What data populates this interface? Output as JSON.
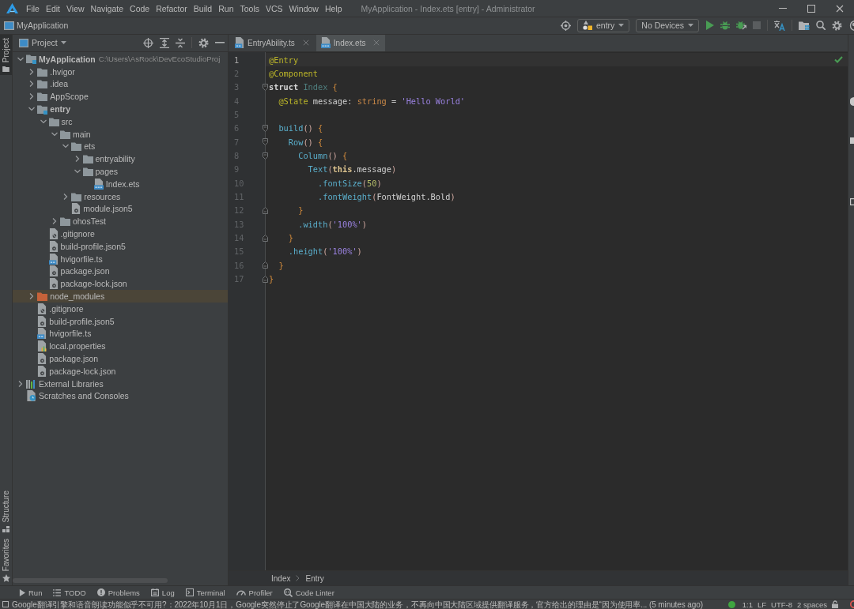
{
  "title_bar": {
    "menu": [
      "File",
      "Edit",
      "View",
      "Navigate",
      "Code",
      "Refactor",
      "Build",
      "Run",
      "Tools",
      "VCS",
      "Window",
      "Help"
    ],
    "title": "MyApplication - Index.ets [entry] - Administrator"
  },
  "nav_bar": {
    "project": "MyApplication",
    "run_config": "entry",
    "device": "No Devices"
  },
  "left_stripe": {
    "top": [
      {
        "label": "Project",
        "kind": "project",
        "selected": true
      }
    ],
    "bottom": [
      {
        "label": "Structure",
        "kind": "structure",
        "selected": false
      },
      {
        "label": "Favorites",
        "kind": "favorites",
        "selected": false
      }
    ]
  },
  "project_panel": {
    "title": "Project",
    "tree": [
      {
        "name": "MyApplication",
        "kind": "module",
        "hint": "C:\\Users\\AsRock\\DevEcoStudioProj",
        "expanded": true,
        "selected": false,
        "children": [
          {
            "name": ".hvigor",
            "kind": "folder",
            "expanded": false,
            "selected": false
          },
          {
            "name": ".idea",
            "kind": "folder",
            "expanded": false,
            "selected": false
          },
          {
            "name": "AppScope",
            "kind": "folder",
            "expanded": false,
            "selected": false
          },
          {
            "name": "entry",
            "kind": "module",
            "expanded": true,
            "selected": false,
            "children": [
              {
                "name": "src",
                "kind": "folder",
                "expanded": true,
                "selected": false,
                "children": [
                  {
                    "name": "main",
                    "kind": "folder",
                    "expanded": true,
                    "selected": false,
                    "children": [
                      {
                        "name": "ets",
                        "kind": "folder",
                        "expanded": true,
                        "selected": false,
                        "children": [
                          {
                            "name": "entryability",
                            "kind": "folder",
                            "expanded": false,
                            "selected": false
                          },
                          {
                            "name": "pages",
                            "kind": "folder",
                            "expanded": true,
                            "selected": false,
                            "children": [
                              {
                                "name": "Index.ets",
                                "kind": "ets",
                                "selected": false
                              }
                            ]
                          }
                        ]
                      },
                      {
                        "name": "resources",
                        "kind": "folder",
                        "expanded": false,
                        "selected": false
                      },
                      {
                        "name": "module.json5",
                        "kind": "json",
                        "selected": false
                      }
                    ]
                  },
                  {
                    "name": "ohosTest",
                    "kind": "folder",
                    "expanded": false,
                    "selected": false
                  }
                ]
              },
              {
                "name": ".gitignore",
                "kind": "ignore",
                "selected": false
              },
              {
                "name": "build-profile.json5",
                "kind": "json",
                "selected": false
              },
              {
                "name": "hvigorfile.ts",
                "kind": "ts",
                "selected": false
              },
              {
                "name": "package.json",
                "kind": "json",
                "selected": false
              },
              {
                "name": "package-lock.json",
                "kind": "json",
                "selected": false
              }
            ]
          },
          {
            "name": "node_modules",
            "kind": "excluded",
            "expanded": false,
            "selected": true
          },
          {
            "name": ".gitignore",
            "kind": "ignore",
            "selected": false
          },
          {
            "name": "build-profile.json5",
            "kind": "json",
            "selected": false
          },
          {
            "name": "hvigorfile.ts",
            "kind": "ts",
            "selected": false
          },
          {
            "name": "local.properties",
            "kind": "properties",
            "selected": false
          },
          {
            "name": "package.json",
            "kind": "json",
            "selected": false
          },
          {
            "name": "package-lock.json",
            "kind": "json",
            "selected": false
          }
        ]
      },
      {
        "name": "External Libraries",
        "kind": "libraries",
        "expanded": false,
        "selected": false
      },
      {
        "name": "Scratches and Consoles",
        "kind": "scratches",
        "selected": false
      }
    ]
  },
  "editor": {
    "tabs": [
      {
        "label": "EntryAbility.ts",
        "kind": "ts",
        "selected": false
      },
      {
        "label": "Index.ets",
        "kind": "ets",
        "selected": true
      }
    ],
    "lines": [
      {
        "number": "1",
        "kind": "plain",
        "current": true,
        "tokens": [
          {
            "text": "@Entry",
            "kind": "annotation"
          }
        ]
      },
      {
        "number": "2",
        "kind": "plain",
        "current": false,
        "tokens": [
          {
            "text": "@Component",
            "kind": "annotation"
          }
        ]
      },
      {
        "number": "3",
        "kind": "fold_start",
        "current": false,
        "tokens": [
          {
            "text": "struct",
            "kind": "keyword"
          },
          {
            "text": " Index",
            "kind": "type"
          },
          {
            "text": " {",
            "kind": "brace"
          }
        ]
      },
      {
        "number": "4",
        "kind": "plain",
        "current": false,
        "tokens": [
          {
            "text": "  @State",
            "kind": "annotation"
          },
          {
            "text": " message",
            "kind": "field"
          },
          {
            "text": ": ",
            "kind": "plain"
          },
          {
            "text": "string",
            "kind": "primitive"
          },
          {
            "text": " = ",
            "kind": "plain"
          },
          {
            "text": "'Hello World'",
            "kind": "string"
          }
        ]
      },
      {
        "number": "5",
        "kind": "plain",
        "current": false
      },
      {
        "number": "6",
        "kind": "fold_start",
        "current": false,
        "tokens": [
          {
            "text": "  build",
            "kind": "call"
          },
          {
            "text": "()",
            "kind": "paren"
          },
          {
            "text": " {",
            "kind": "brace"
          }
        ]
      },
      {
        "number": "7",
        "kind": "fold_start",
        "current": false,
        "tokens": [
          {
            "text": "    Row",
            "kind": "call"
          },
          {
            "text": "()",
            "kind": "paren"
          },
          {
            "text": " {",
            "kind": "brace"
          }
        ]
      },
      {
        "number": "8",
        "kind": "fold_start",
        "current": false,
        "tokens": [
          {
            "text": "      Column",
            "kind": "call"
          },
          {
            "text": "()",
            "kind": "paren"
          },
          {
            "text": " {",
            "kind": "brace"
          }
        ]
      },
      {
        "number": "9",
        "kind": "plain",
        "current": false,
        "tokens": [
          {
            "text": "        Text",
            "kind": "call"
          },
          {
            "text": "(",
            "kind": "paren"
          },
          {
            "text": "this",
            "kind": "self"
          },
          {
            "text": ".message",
            "kind": "field"
          },
          {
            "text": ")",
            "kind": "paren"
          }
        ]
      },
      {
        "number": "10",
        "kind": "plain",
        "current": false,
        "tokens": [
          {
            "text": "          .fontSize",
            "kind": "call"
          },
          {
            "text": "(",
            "kind": "paren"
          },
          {
            "text": "50",
            "kind": "number"
          },
          {
            "text": ")",
            "kind": "paren"
          }
        ]
      },
      {
        "number": "11",
        "kind": "plain",
        "current": false,
        "tokens": [
          {
            "text": "          .fontWeight",
            "kind": "call"
          },
          {
            "text": "(",
            "kind": "paren"
          },
          {
            "text": "FontWeight.Bold",
            "kind": "field"
          },
          {
            "text": ")",
            "kind": "paren"
          }
        ]
      },
      {
        "number": "12",
        "kind": "fold_end",
        "current": false,
        "tokens": [
          {
            "text": "      }",
            "kind": "brace"
          }
        ]
      },
      {
        "number": "13",
        "kind": "plain",
        "current": false,
        "tokens": [
          {
            "text": "      .width",
            "kind": "call"
          },
          {
            "text": "(",
            "kind": "paren"
          },
          {
            "text": "'100%'",
            "kind": "string"
          },
          {
            "text": ")",
            "kind": "paren"
          }
        ]
      },
      {
        "number": "14",
        "kind": "fold_end",
        "current": false,
        "tokens": [
          {
            "text": "    }",
            "kind": "brace"
          }
        ]
      },
      {
        "number": "15",
        "kind": "plain",
        "current": false,
        "tokens": [
          {
            "text": "    .height",
            "kind": "call"
          },
          {
            "text": "(",
            "kind": "paren"
          },
          {
            "text": "'100%'",
            "kind": "string"
          },
          {
            "text": ")",
            "kind": "paren"
          }
        ]
      },
      {
        "number": "16",
        "kind": "fold_end",
        "current": false,
        "tokens": [
          {
            "text": "  }",
            "kind": "brace"
          }
        ]
      },
      {
        "number": "17",
        "kind": "fold_end",
        "current": false,
        "tokens": [
          {
            "text": "}",
            "kind": "brace"
          }
        ]
      }
    ],
    "breadcrumb": [
      "Index",
      "Entry"
    ]
  },
  "tool_windows_bar": [
    {
      "label": "Run",
      "kind": "run"
    },
    {
      "label": "TODO",
      "kind": "todo"
    },
    {
      "label": "Problems",
      "kind": "problems"
    },
    {
      "label": "Log",
      "kind": "log"
    },
    {
      "label": "Terminal",
      "kind": "terminal"
    },
    {
      "label": "Profiler",
      "kind": "profiler"
    },
    {
      "label": "Code Linter",
      "kind": "linter"
    }
  ],
  "status_bar": {
    "message": "Google翻译引擎和语音朗读功能似乎不可用?：2022年10月1日，Google突然停止了Google翻译在中国大陆的业务，不再向中国大陆区域提供翻译服务，官方给出的理由是“因为使用率... (5 minutes ago)",
    "fields": [
      "1:1",
      "LF",
      "UTF-8",
      "2 spaces"
    ]
  }
}
